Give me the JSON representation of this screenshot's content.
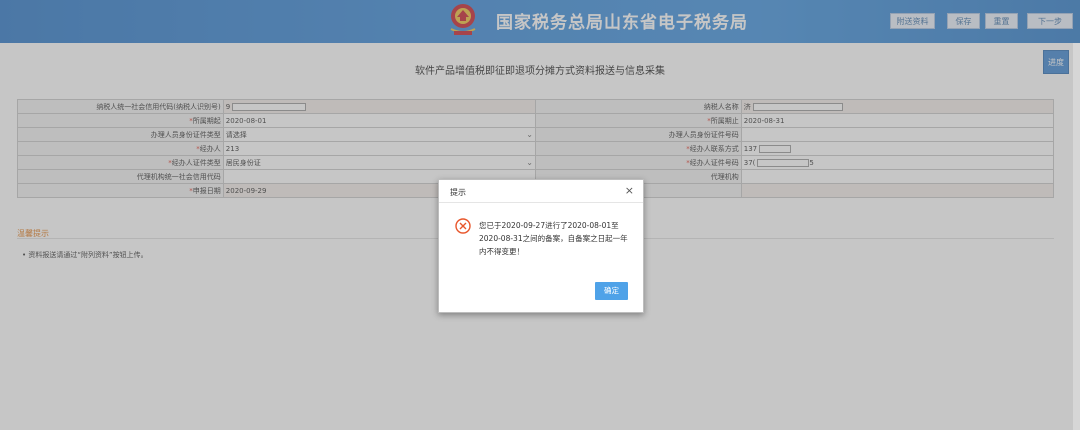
{
  "header": {
    "site_title": "国家税务总局山东省电子税务局",
    "buttons": [
      "附送资料",
      "保存",
      "重置",
      "下一步"
    ]
  },
  "page": {
    "title": "软件产品增值税即征即退项分摊方式资料报送与信息采集",
    "progress_label": "进度"
  },
  "form": {
    "rows": [
      {
        "left_label": "纳税人统一社会信用代码(纳税人识别号)",
        "left_required": false,
        "left_value": "9",
        "left_masked": true,
        "right_label": "纳税人名称",
        "right_required": false,
        "right_value": "济",
        "right_masked": true,
        "shaded": true
      },
      {
        "left_label": "所属期起",
        "left_required": true,
        "left_value": "2020-08-01",
        "left_masked": false,
        "right_label": "所属期止",
        "right_required": true,
        "right_value": "2020-08-31",
        "right_masked": false,
        "shaded": false
      },
      {
        "left_label": "办理人员身份证件类型",
        "left_required": false,
        "left_value": "请选择",
        "left_dropdown": true,
        "right_label": "办理人员身份证件号码",
        "right_required": false,
        "right_value": "",
        "shaded": false
      },
      {
        "left_label": "经办人",
        "left_required": true,
        "left_value": "213",
        "right_label": "经办人联系方式",
        "right_required": true,
        "right_value": "137",
        "right_masked": true,
        "shaded": false
      },
      {
        "left_label": "经办人证件类型",
        "left_required": true,
        "left_value": "居民身份证",
        "left_dropdown": true,
        "right_label": "经办人证件号码",
        "right_required": true,
        "right_value": "37(",
        "right_suffix": "5",
        "right_masked": true,
        "shaded": false
      },
      {
        "left_label": "代理机构统一社会信用代码",
        "left_required": false,
        "left_value": "",
        "right_label": "代理机构",
        "right_required": false,
        "right_value": "",
        "shaded": false
      },
      {
        "left_label": "申报日期",
        "left_required": true,
        "left_value": "2020-09-29",
        "right_label": "",
        "right_required": false,
        "right_value": "",
        "shaded": true
      }
    ]
  },
  "tips": {
    "title": "温馨提示",
    "items": [
      "资料报送请通过“附列资料”按钮上传。"
    ]
  },
  "dialog": {
    "title": "提示",
    "close_icon": "×",
    "message": "您已于2020-09-27进行了2020-08-01至2020-08-31之间的备案，自备案之日起一年内不得变更！",
    "ok_label": "确定"
  },
  "colors": {
    "header_blue": "#3a8ad8",
    "required": "#e0392b",
    "tips_orange": "#e07a1e",
    "ok_button": "#4fa2e8",
    "error_icon": "#e8562b"
  }
}
